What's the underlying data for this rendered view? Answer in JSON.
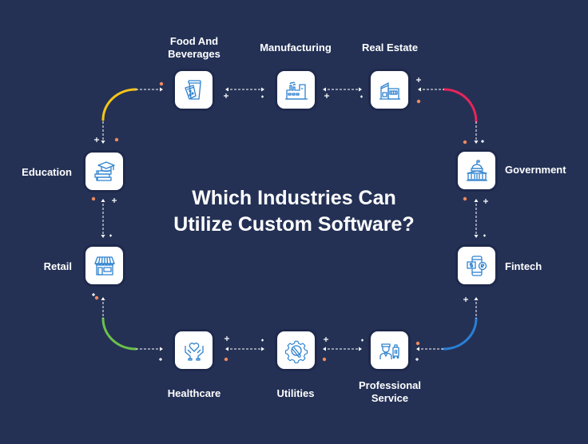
{
  "title": {
    "line1": "Which Industries Can",
    "line2": "Utilize Custom Software?"
  },
  "colors": {
    "background": "#243155",
    "icon_stroke": "#2f82cf",
    "dot": "#f08a5d",
    "arc_top_left": "#f5c518",
    "arc_top_right": "#e8245a",
    "arc_bottom_right": "#2a7fd4",
    "arc_bottom_left": "#6cc04a"
  },
  "industries": [
    {
      "id": "food",
      "label_line1": "Food And",
      "label_line2": "Beverages",
      "icon": "food-beverage-icon"
    },
    {
      "id": "manufacturing",
      "label_line1": "Manufacturing",
      "icon": "factory-icon"
    },
    {
      "id": "real-estate",
      "label_line1": "Real Estate",
      "icon": "building-icon"
    },
    {
      "id": "government",
      "label_line1": "Government",
      "icon": "capitol-icon"
    },
    {
      "id": "fintech",
      "label_line1": "Fintech",
      "icon": "mobile-payment-icon"
    },
    {
      "id": "professional",
      "label_line1": "Professional",
      "label_line2": "Service",
      "icon": "bellhop-luggage-icon"
    },
    {
      "id": "utilities",
      "label_line1": "Utilities",
      "icon": "gear-wrench-icon"
    },
    {
      "id": "healthcare",
      "label_line1": "Healthcare",
      "icon": "heart-hands-icon"
    },
    {
      "id": "retail",
      "label_line1": "Retail",
      "icon": "storefront-icon"
    },
    {
      "id": "education",
      "label_line1": "Education",
      "icon": "graduation-books-icon"
    }
  ]
}
